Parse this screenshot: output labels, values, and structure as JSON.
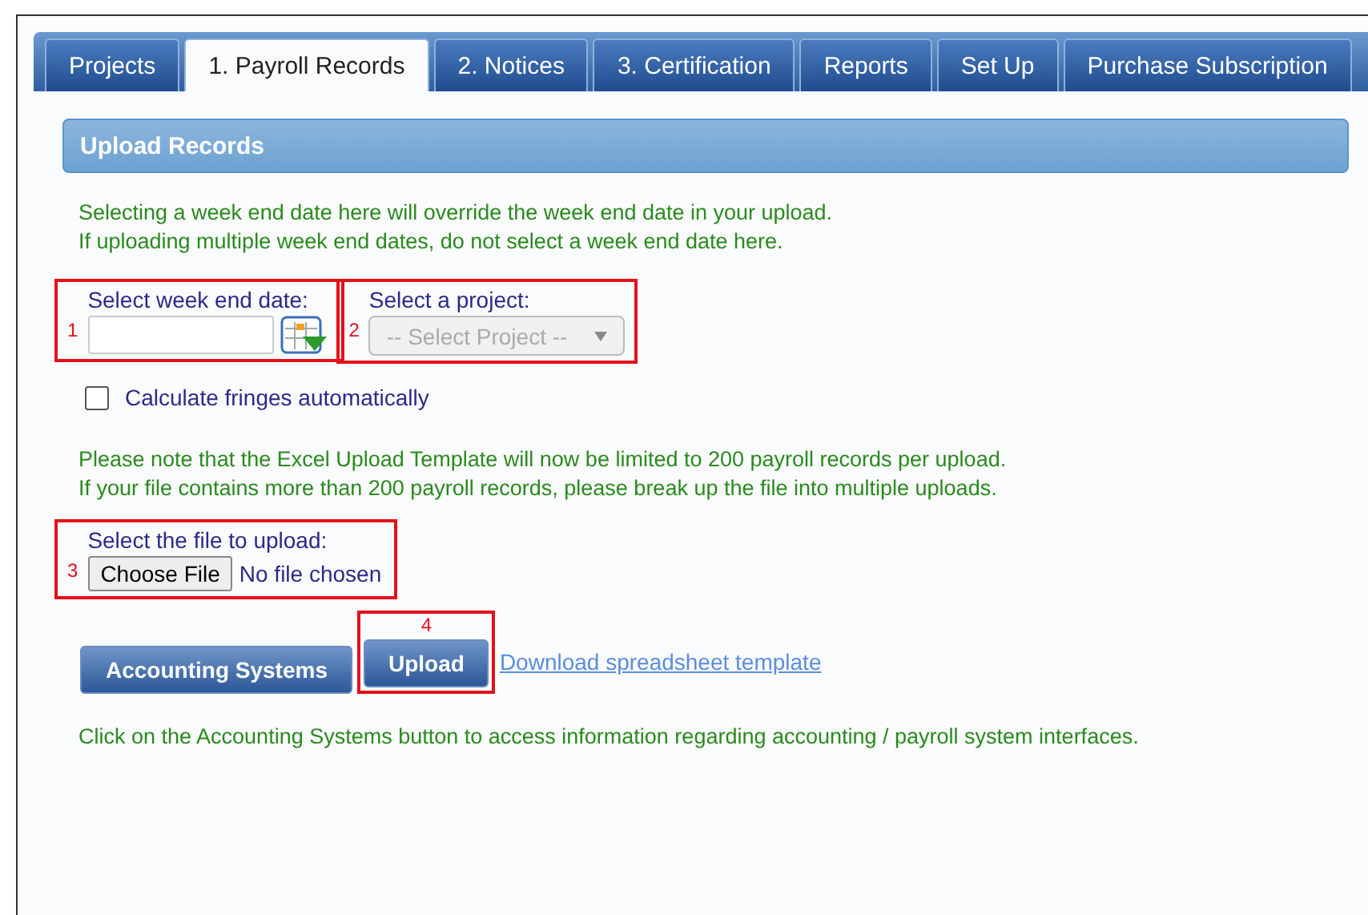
{
  "tabs": [
    {
      "label": "Projects",
      "selected": false
    },
    {
      "label": "1. Payroll Records",
      "selected": true
    },
    {
      "label": "2. Notices",
      "selected": false
    },
    {
      "label": "3. Certification",
      "selected": false
    },
    {
      "label": "Reports",
      "selected": false
    },
    {
      "label": "Set Up",
      "selected": false
    },
    {
      "label": "Purchase Subscription",
      "selected": false
    }
  ],
  "section_title": "Upload Records",
  "intro_notes": [
    "Selecting a week end date here will override the week end date in your upload.",
    "If uploading multiple week end dates, do not select a week end date here."
  ],
  "week_end_date": {
    "marker": "1",
    "label": "Select week end date:"
  },
  "project": {
    "marker": "2",
    "label": "Select a project:",
    "placeholder": "-- Select Project --",
    "disabled": true
  },
  "calculate_fringes": {
    "label": "Calculate fringes automatically",
    "checked": false
  },
  "limit_notes": [
    "Please note that the Excel Upload Template will now be limited to 200 payroll records per upload.",
    "If your file contains more than 200 payroll records, please break up the file into multiple uploads."
  ],
  "file": {
    "marker": "3",
    "label": "Select the file to upload:",
    "button": "Choose File",
    "status": "No file chosen"
  },
  "accounting_button": "Accounting Systems",
  "upload": {
    "marker": "4",
    "button": "Upload"
  },
  "template_link": "Download spreadsheet template",
  "footer_note": "Click on the Accounting Systems button to access information regarding accounting / payroll system interfaces."
}
